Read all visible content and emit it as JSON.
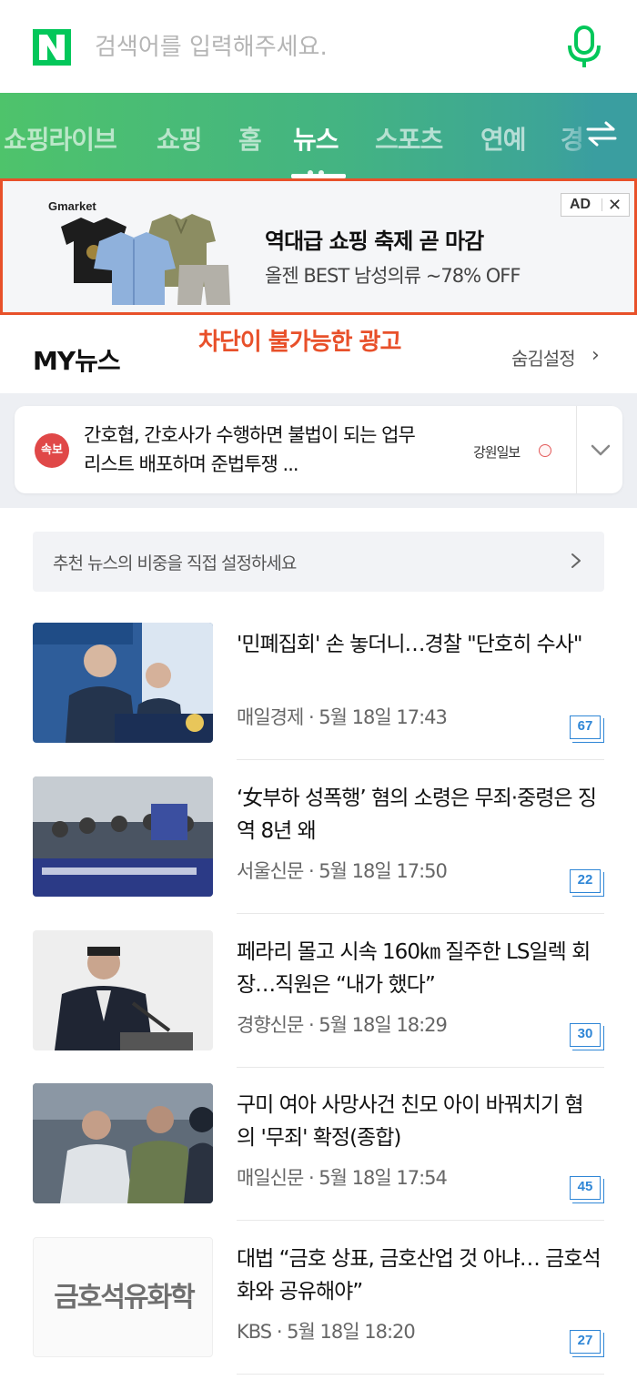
{
  "search": {
    "logo": "N",
    "placeholder": "검색어를 입력해주세요.",
    "mic_icon": "mic-icon",
    "brand_color": "#03c75a"
  },
  "tabs": {
    "items": [
      "쇼핑라이브",
      "쇼핑",
      "홈",
      "뉴스",
      "스포츠",
      "연예",
      "경"
    ],
    "active": "뉴스",
    "swap_icon": "swap-arrows-icon"
  },
  "ad": {
    "brand": "Gmarket",
    "title": "역대급 쇼핑 축제 곧 마감",
    "subtitle": "올젠 BEST 남성의류 ~78% OFF",
    "badge_label": "AD",
    "close_label": "✕",
    "border_color": "#e8512a"
  },
  "annotation": "차단이 불가능한 광고",
  "mynews": {
    "title": "MY뉴스",
    "hide_settings": "숨김설정",
    "chevron": "›"
  },
  "breaking": {
    "badge": "속보",
    "text": "간호협, 간호사가 수행하면 불법이 되는 업무 리스트 배포하며 준법투쟁 ...",
    "source": "강원일보"
  },
  "recommend": {
    "text": "추천 뉴스의 비중을 직접 설정하세요"
  },
  "articles": [
    {
      "title": "'민폐집회' 손 놓더니…경찰 \"단호히 수사\"",
      "meta": "매일경제 · 5월 18일 17:43",
      "comments": "67"
    },
    {
      "title": "‘女부하 성폭행’ 혐의 소령은 무죄·중령은 징역 8년 왜",
      "meta": "서울신문 · 5월 18일 17:50",
      "comments": "22"
    },
    {
      "title": "페라리 몰고 시속 160㎞ 질주한 LS일렉 회장…직원은 “내가 했다”",
      "meta": "경향신문 · 5월 18일 18:29",
      "comments": "30"
    },
    {
      "title": "구미 여아 사망사건 친모 아이 바꿔치기 혐의 '무죄' 확정(종합)",
      "meta": "매일신문 · 5월 18일 17:54",
      "comments": "45"
    },
    {
      "title": "대법 “금호 상표, 금호산업 것 아냐… 금호석화와 공유해야”",
      "meta": "KBS · 5월 18일 18:20",
      "comments": "27",
      "thumb_text": "금호석유화학"
    }
  ]
}
